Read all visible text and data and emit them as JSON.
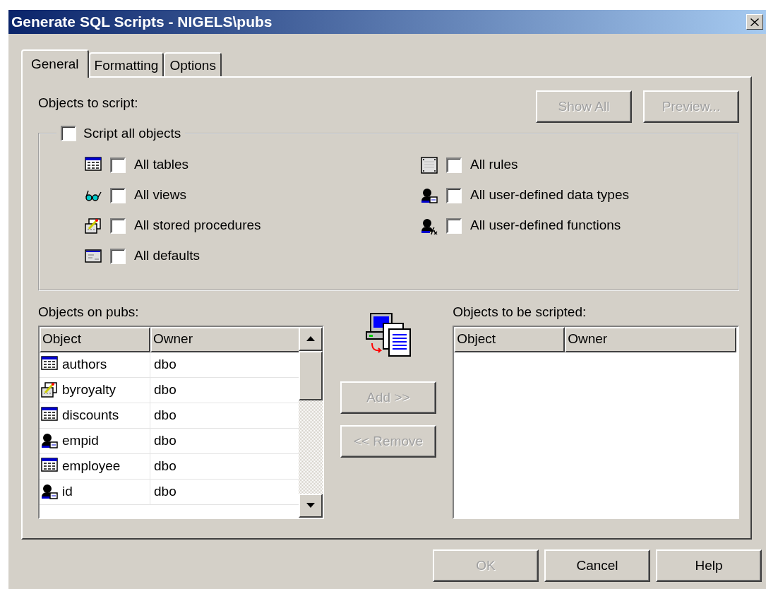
{
  "window": {
    "title": "Generate SQL Scripts - NIGELS\\pubs"
  },
  "tabs": [
    {
      "label": "General",
      "selected": true
    },
    {
      "label": "Formatting",
      "selected": false
    },
    {
      "label": "Options",
      "selected": false
    }
  ],
  "objects_to_script": {
    "label": "Objects to script:",
    "buttons": [
      {
        "label": "Show All",
        "disabled": true
      },
      {
        "label": "Preview...",
        "disabled": true
      }
    ]
  },
  "script_all": {
    "label": "Script all objects",
    "checked": false
  },
  "object_types_left": [
    {
      "kind": "table",
      "label": "All tables",
      "checked": false
    },
    {
      "kind": "view",
      "label": "All views",
      "checked": false
    },
    {
      "kind": "procedure",
      "label": "All stored procedures",
      "checked": false
    },
    {
      "kind": "default",
      "label": "All defaults",
      "checked": false
    }
  ],
  "object_types_right": [
    {
      "kind": "rule",
      "label": "All rules",
      "checked": false
    },
    {
      "kind": "datatype",
      "label": "All user-defined data types",
      "checked": false
    },
    {
      "kind": "function",
      "label": "All user-defined functions",
      "checked": false
    }
  ],
  "source_list": {
    "label": "Objects on pubs:",
    "columns": [
      "Object",
      "Owner"
    ],
    "rows": [
      {
        "kind": "table",
        "object": "authors",
        "owner": "dbo"
      },
      {
        "kind": "procedure",
        "object": "byroyalty",
        "owner": "dbo"
      },
      {
        "kind": "table",
        "object": "discounts",
        "owner": "dbo"
      },
      {
        "kind": "datatype",
        "object": "empid",
        "owner": "dbo"
      },
      {
        "kind": "table",
        "object": "employee",
        "owner": "dbo"
      },
      {
        "kind": "datatype",
        "object": "id",
        "owner": "dbo"
      }
    ]
  },
  "transfer_buttons": [
    {
      "label": "Add >>",
      "disabled": true
    },
    {
      "label": "<< Remove",
      "disabled": true
    }
  ],
  "target_list": {
    "label": "Objects to be scripted:",
    "columns": [
      "Object",
      "Owner"
    ]
  },
  "dialog_buttons": [
    {
      "label": "OK",
      "disabled": true
    },
    {
      "label": "Cancel",
      "disabled": false
    },
    {
      "label": "Help",
      "disabled": false
    }
  ]
}
